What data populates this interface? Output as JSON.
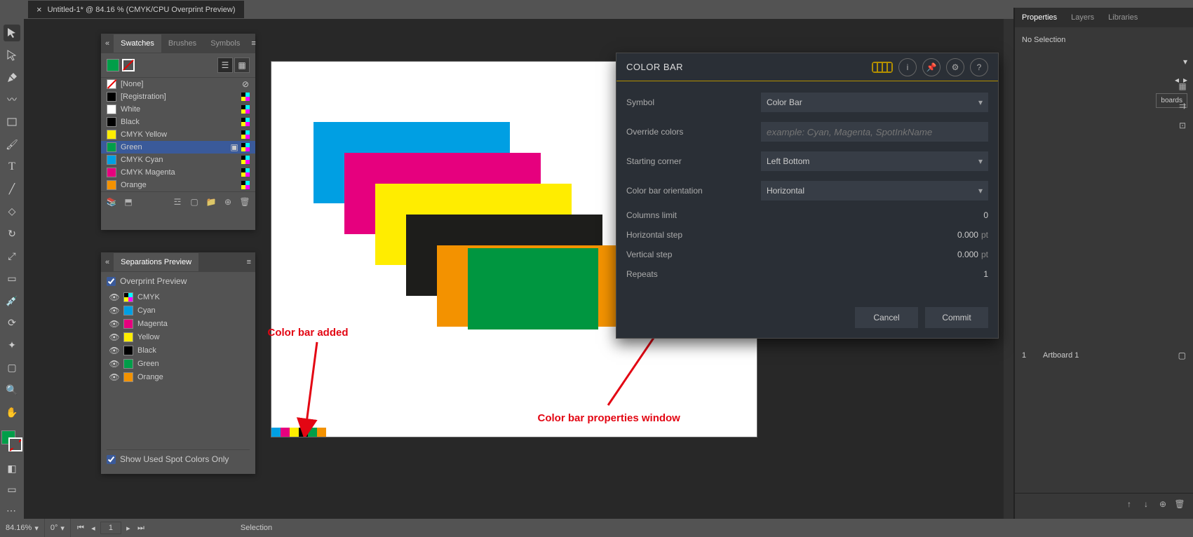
{
  "document": {
    "tab_title": "Untitled-1* @ 84.16 % (CMYK/CPU Overprint Preview)"
  },
  "swatches": {
    "tabs": [
      "Swatches",
      "Brushes",
      "Symbols"
    ],
    "items": [
      {
        "name": "[None]",
        "color": "none"
      },
      {
        "name": "[Registration]",
        "color": "#000"
      },
      {
        "name": "White",
        "color": "#fff"
      },
      {
        "name": "Black",
        "color": "#000"
      },
      {
        "name": "CMYK Yellow",
        "color": "#ffed00"
      },
      {
        "name": "Green",
        "color": "#009e49"
      },
      {
        "name": "CMYK Cyan",
        "color": "#009fe3"
      },
      {
        "name": "CMYK Magenta",
        "color": "#e6007e"
      },
      {
        "name": "Orange",
        "color": "#f39200"
      }
    ]
  },
  "separations": {
    "title": "Separations Preview",
    "overprint_label": "Overprint Preview",
    "items": [
      {
        "name": "CMYK",
        "color": "cmyk"
      },
      {
        "name": "Cyan",
        "color": "#009fe3"
      },
      {
        "name": "Magenta",
        "color": "#e6007e"
      },
      {
        "name": "Yellow",
        "color": "#ffed00"
      },
      {
        "name": "Black",
        "color": "#000"
      },
      {
        "name": "Green",
        "color": "#009e49"
      },
      {
        "name": "Orange",
        "color": "#f39200"
      }
    ],
    "footer_label": "Show Used Spot Colors Only"
  },
  "dialog": {
    "title": "COLOR BAR",
    "labels": {
      "symbol": "Symbol",
      "override": "Override colors",
      "corner": "Starting corner",
      "orientation": "Color bar orientation",
      "columns": "Columns limit",
      "hstep": "Horizontal step",
      "vstep": "Vertical step",
      "repeats": "Repeats"
    },
    "values": {
      "symbol": "Color Bar",
      "corner": "Left Bottom",
      "orientation": "Horizontal",
      "columns": "0",
      "hstep": "0.000",
      "vstep": "0.000",
      "repeats": "1",
      "unit": "pt",
      "override_placeholder": "example: Cyan, Magenta, SpotInkName"
    },
    "buttons": {
      "cancel": "Cancel",
      "commit": "Commit"
    }
  },
  "right": {
    "tabs": [
      "Properties",
      "Layers",
      "Libraries"
    ],
    "no_selection": "No Selection",
    "artboards_btn": "boards",
    "artboard": {
      "num": "1",
      "name": "Artboard 1"
    }
  },
  "status": {
    "zoom": "84.16%",
    "angle": "0°",
    "page": "1",
    "tool": "Selection"
  },
  "annotations": {
    "added": "Color bar added",
    "props": "Color bar properties window"
  },
  "colorbar_marks": [
    "#009fe3",
    "#e6007e",
    "#ffed00",
    "#000",
    "#009e49",
    "#f39200"
  ]
}
